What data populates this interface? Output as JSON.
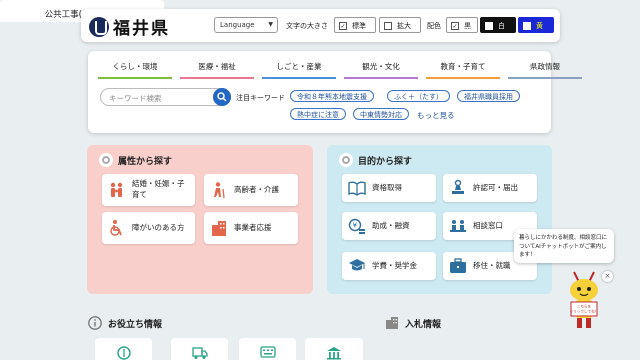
{
  "header": {
    "logo_text": "福井県",
    "language_label": "Language",
    "font_size_label": "文字の大きさ",
    "font_standard": "標準",
    "font_large": "拡大",
    "color_label": "配色",
    "color_black": "黒",
    "color_white": "白",
    "color_yellow": "黄",
    "colors": {
      "dark": "#111111",
      "blue": "#1b28d8",
      "yellow": "#ffff00"
    }
  },
  "nav": {
    "items": [
      {
        "label": "くらし・環境",
        "color": "#7fbf3f"
      },
      {
        "label": "医療・福祉",
        "color": "#e8778f"
      },
      {
        "label": "しごと・産業",
        "color": "#4b8fd9"
      },
      {
        "label": "観光・文化",
        "color": "#b07ad6"
      },
      {
        "label": "教育・子育て",
        "color": "#f29d38"
      },
      {
        "label": "県政情報",
        "color": "#8aa0c2"
      }
    ]
  },
  "search": {
    "placeholder": "キーワード検索",
    "keywords_label": "注目キーワード",
    "keywords": [
      "令和８年熊本地震支援",
      "ふく＋（たす）",
      "福井県職員採用",
      "熱中症に注意",
      "中東情勢対応"
    ],
    "more_label": "もっと見る"
  },
  "attributes": {
    "title": "属性から探す",
    "items": [
      {
        "label": "結婚・妊娠・子育て",
        "icon": "family-icon"
      },
      {
        "label": "高齢者・介護",
        "icon": "elderly-icon"
      },
      {
        "label": "障がいのある方",
        "icon": "wheelchair-icon"
      },
      {
        "label": "事業者応援",
        "icon": "building-icon"
      }
    ]
  },
  "purposes": {
    "title": "目的から探す",
    "items": [
      {
        "label": "資格取得",
        "icon": "book-icon"
      },
      {
        "label": "許認可・届出",
        "icon": "stamp-icon"
      },
      {
        "label": "助成・融資",
        "icon": "coins-icon"
      },
      {
        "label": "相談窓口",
        "icon": "consult-icon"
      },
      {
        "label": "学費・奨学金",
        "icon": "graduation-icon"
      },
      {
        "label": "移住・就職",
        "icon": "briefcase-icon"
      }
    ]
  },
  "help_bubble": {
    "text": "暮らしにかかわる制度、相談窓口についてAIチャットボットがご案内します！",
    "mascot_label": "こちらをクリックしてね！",
    "close": "×"
  },
  "useful": {
    "title": "お役立ち情報"
  },
  "bidding": {
    "title": "入札情報",
    "item": "公共工事(電子入札)"
  }
}
